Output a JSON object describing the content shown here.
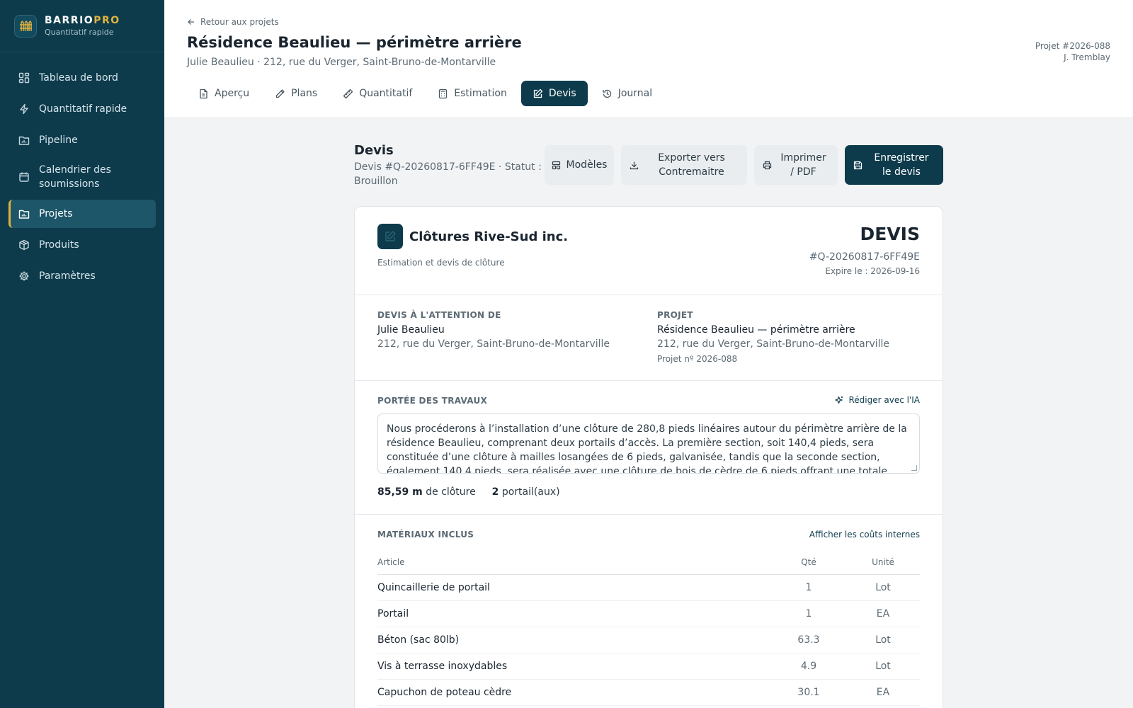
{
  "brand": {
    "name_part1": "BARRIO",
    "name_part2": "PRO",
    "subtitle": "Quantitatif rapide"
  },
  "sidebar": {
    "items": [
      {
        "label": "Tableau de bord",
        "icon": "dashboard-icon"
      },
      {
        "label": "Quantitatif rapide",
        "icon": "lightning-icon"
      },
      {
        "label": "Pipeline",
        "icon": "folder-chart-icon"
      },
      {
        "label": "Calendrier des soumissions",
        "icon": "calendar-icon"
      },
      {
        "label": "Projets",
        "icon": "folder-chart-icon",
        "active": true
      },
      {
        "label": "Produits",
        "icon": "package-icon"
      },
      {
        "label": "Paramètres",
        "icon": "gear-icon"
      }
    ]
  },
  "header": {
    "back_label": "Retour aux projets",
    "title": "Résidence Beaulieu — périmètre arrière",
    "subtitle": "Julie Beaulieu · 212, rue du Verger, Saint-Bruno-de-Montarville",
    "project_number": "Projet #2026-088",
    "owner": "J. Tremblay",
    "tabs": [
      {
        "label": "Aperçu",
        "icon": "document-icon"
      },
      {
        "label": "Plans",
        "icon": "pencil-icon"
      },
      {
        "label": "Quantitatif",
        "icon": "ruler-icon"
      },
      {
        "label": "Estimation",
        "icon": "calculator-icon"
      },
      {
        "label": "Devis",
        "icon": "edit-icon",
        "active": true
      },
      {
        "label": "Journal",
        "icon": "history-icon"
      }
    ]
  },
  "quote_header": {
    "title": "Devis",
    "subtitle": "Devis #Q-20260817-6FF49E · Statut : Brouillon",
    "buttons": {
      "templates": "Modèles",
      "export": "Exporter vers Contremaitre",
      "print": "Imprimer / PDF",
      "save": "Enregistrer le devis"
    }
  },
  "quote": {
    "company_name": "Clôtures Rive-Sud inc.",
    "company_tagline": "Estimation et devis de clôture",
    "doc_type": "DEVIS",
    "doc_number": "#Q-20260817-6FF49E",
    "expiry": "Expire le : 2026-09-16",
    "attention": {
      "label": "DEVIS À L'ATTENTION DE",
      "name": "Julie Beaulieu",
      "address": "212, rue du Verger, Saint-Bruno-de-Montarville"
    },
    "project": {
      "label": "PROJET",
      "name": "Résidence Beaulieu — périmètre arrière",
      "address": "212, rue du Verger, Saint-Bruno-de-Montarville",
      "number": "Projet nº 2026-088"
    },
    "scope": {
      "label": "PORTÉE DES TRAVAUX",
      "ai_label": "Rédiger avec l'IA",
      "text": "Nous procéderons à l’installation d’une clôture de 280,8 pieds linéaires autour du périmètre arrière de la résidence Beaulieu, comprenant deux portails d’accès. La première section, soit 140,4 pieds, sera constituée d’une clôture à mailles losangées de 6 pieds, galvanisée, tandis que la seconde section, également 140,4 pieds, sera réalisée avec une clôture de bois de cèdre de 6 pieds offrant une totale intimité.",
      "fence_length": "85,59 m",
      "fence_label": "de clôture",
      "gate_count": "2",
      "gate_label": "portail(aux)"
    },
    "materials": {
      "label": "MATÉRIAUX INCLUS",
      "cost_toggle": "Afficher les coûts internes",
      "columns": {
        "article": "Article",
        "qty": "Qté",
        "unit": "Unité"
      },
      "rows": [
        {
          "article": "Quincaillerie de portail",
          "qty": "1",
          "unit": "Lot"
        },
        {
          "article": "Portail",
          "qty": "1",
          "unit": "EA"
        },
        {
          "article": "Béton (sac 80lb)",
          "qty": "63.3",
          "unit": "Lot"
        },
        {
          "article": "Vis à terrasse inoxydables",
          "qty": "4.9",
          "unit": "Lot"
        },
        {
          "article": "Capuchon de poteau cèdre",
          "qty": "30.1",
          "unit": "EA"
        }
      ]
    }
  },
  "colors": {
    "sidebar": "#0d3b4c",
    "accent": "#e0b341",
    "primary": "#0d3b4c"
  }
}
